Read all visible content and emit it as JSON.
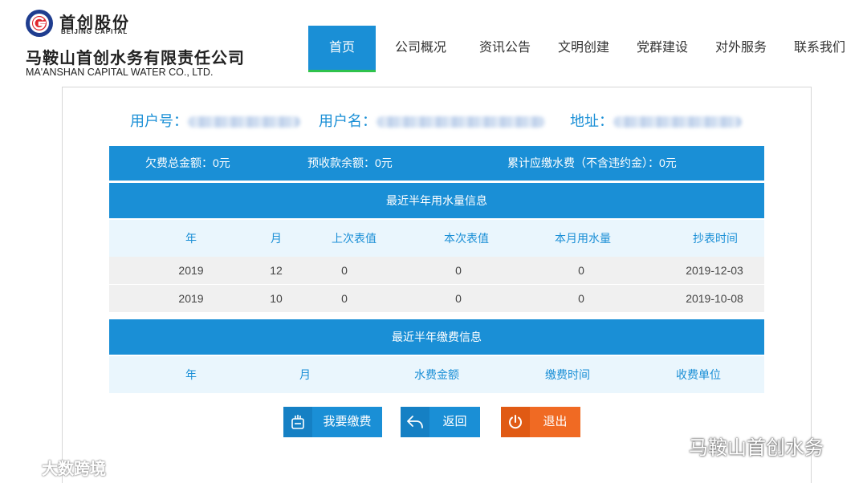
{
  "brand": {
    "logo_cn": "首创股份",
    "logo_en": "BEIJING CAPITAL",
    "company_cn": "马鞍山首创水务有限责任公司",
    "company_en": "MA'ANSHAN CAPITAL WATER CO., LTD.",
    "logo_color_blue": "#1f3d8f",
    "logo_color_red": "#e0252b"
  },
  "nav": {
    "items": [
      {
        "label": "首页"
      },
      {
        "label": "公司概况"
      },
      {
        "label": "资讯公告"
      },
      {
        "label": "文明创建"
      },
      {
        "label": "党群建设"
      },
      {
        "label": "对外服务"
      },
      {
        "label": "联系我们"
      }
    ],
    "active_index": 0
  },
  "user": {
    "user_no_label": "用户号：",
    "user_name_label": "用户名：",
    "address_label": "地址："
  },
  "summary": {
    "arrears": "欠费总金额：0元",
    "prepaid": "预收款余额：0元",
    "cumulative": "累计应缴水费（不含违约金）：0元"
  },
  "usage": {
    "title": "最近半年用水量信息",
    "headers": [
      "年",
      "月",
      "上次表值",
      "本次表值",
      "本月用水量",
      "抄表时间"
    ],
    "rows": [
      [
        "2019",
        "12",
        "0",
        "0",
        "0",
        "2019-12-03"
      ],
      [
        "2019",
        "10",
        "0",
        "0",
        "0",
        "2019-10-08"
      ]
    ]
  },
  "payments": {
    "title": "最近半年缴费信息",
    "headers": [
      "年",
      "月",
      "水费金额",
      "缴费时间",
      "收费单位"
    ]
  },
  "buttons": {
    "pay": "我要缴费",
    "back": "返回",
    "exit": "退出"
  },
  "watermarks": {
    "left": "大数跨境",
    "right": "马鞍山首创水务"
  },
  "colors": {
    "primary": "#1a8fd6",
    "accent_green": "#2fc24c",
    "exit_orange": "#f06a23"
  }
}
